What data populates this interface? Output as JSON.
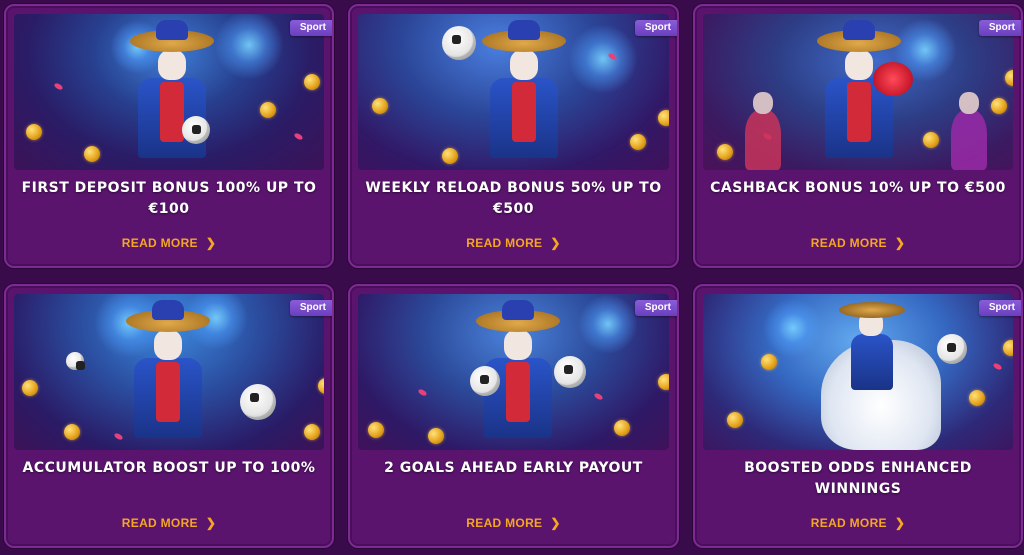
{
  "cards": [
    {
      "badge": "Sport",
      "title": "FIRST DEPOSIT BONUS 100% UP TO €100",
      "link": "READ MORE"
    },
    {
      "badge": "Sport",
      "title": "WEEKLY RELOAD BONUS 50% UP TO €500",
      "link": "READ MORE"
    },
    {
      "badge": "Sport",
      "title": "CASHBACK BONUS 10% UP TO €500",
      "link": "READ MORE"
    },
    {
      "badge": "Sport",
      "title": "ACCUMULATOR BOOST UP TO 100%",
      "link": "READ MORE"
    },
    {
      "badge": "Sport",
      "title": "2 GOALS AHEAD EARLY PAYOUT",
      "link": "READ MORE"
    },
    {
      "badge": "Sport",
      "title": "BOOSTED ODDS ENHANCED WINNINGS",
      "link": "READ MORE"
    }
  ],
  "icons": {
    "chevron": "chevron-right-icon"
  },
  "colors": {
    "background": "#3a0b4a",
    "card": "#5a146e",
    "link": "#f5a623",
    "badge": "#7a4fd0"
  }
}
